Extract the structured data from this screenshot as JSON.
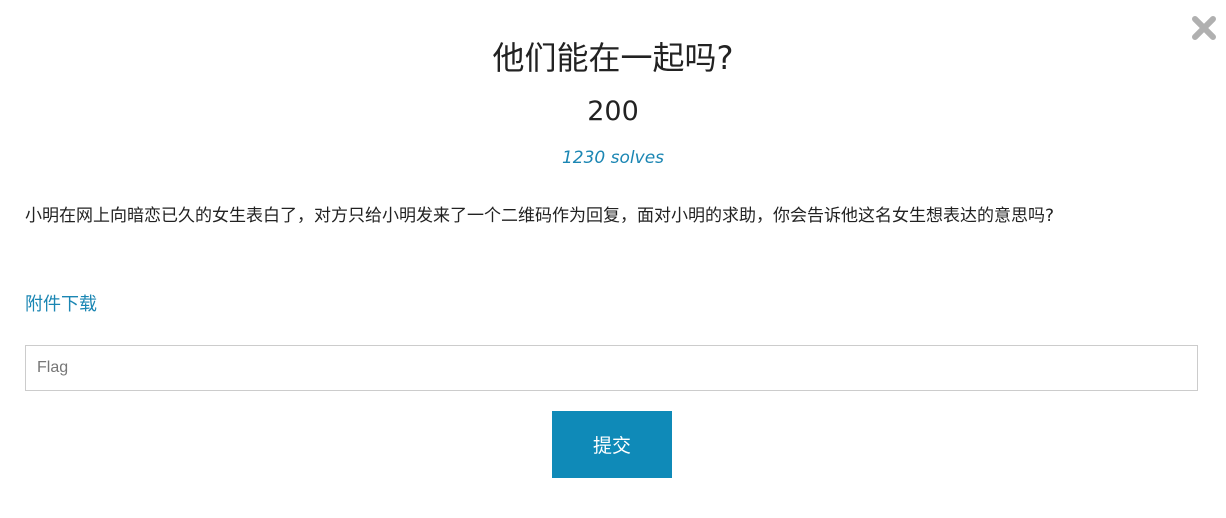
{
  "challenge": {
    "title": "他们能在一起吗?",
    "points": "200",
    "solves": "1230 solves",
    "description": "小明在网上向暗恋已久的女生表白了，对方只给小明发来了一个二维码作为回复，面对小明的求助，你会告诉他这名女生想表达的意思吗?",
    "attachment_label": "附件下载"
  },
  "form": {
    "flag_placeholder": "Flag",
    "flag_value": "",
    "submit_label": "提交"
  },
  "icons": {
    "close": "close-icon"
  },
  "colors": {
    "accent": "#1b86b3",
    "button": "#0f8ab8",
    "close_icon": "#b0b0b0"
  }
}
